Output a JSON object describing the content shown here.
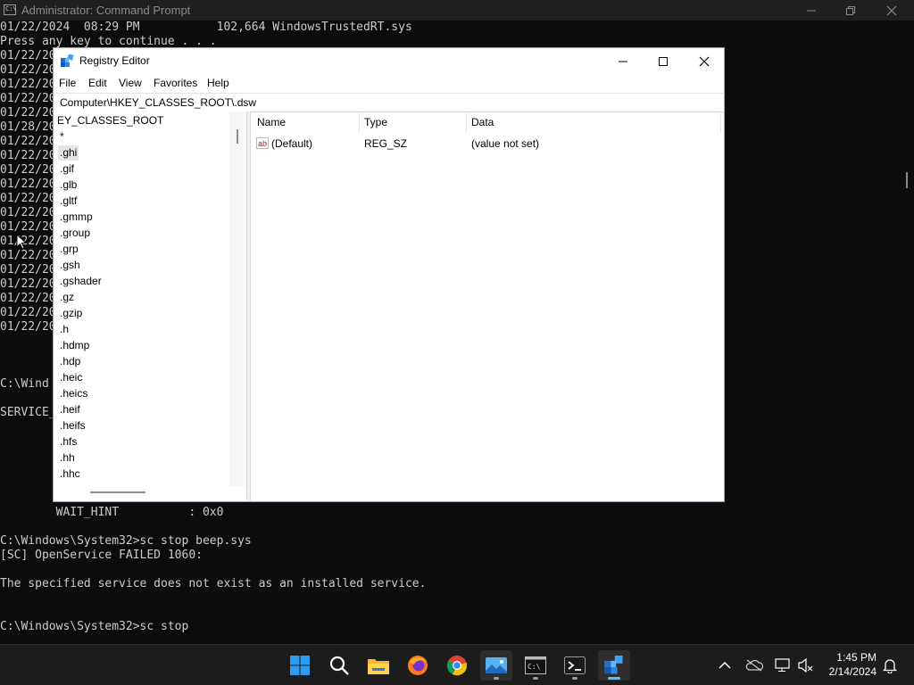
{
  "cmd": {
    "title": "Administrator: Command Prompt",
    "lines": [
      {
        "text": "01/22/2024  08:29 PM           102,664 WindowsTrustedRT.sys",
        "row": 0
      },
      {
        "text": "Press any key to continue . . .",
        "row": 1
      },
      {
        "text": "01/22/20",
        "row": 2
      },
      {
        "text": "01/22/20",
        "row": 3
      },
      {
        "text": "01/22/20",
        "row": 4
      },
      {
        "text": "01/22/20",
        "row": 5
      },
      {
        "text": "01/22/20",
        "row": 6
      },
      {
        "text": "01/28/20",
        "row": 7
      },
      {
        "text": "01/22/20",
        "row": 8
      },
      {
        "text": "01/22/20",
        "row": 9
      },
      {
        "text": "01/22/20",
        "row": 10
      },
      {
        "text": "01/22/20",
        "row": 11
      },
      {
        "text": "01/22/20",
        "row": 12
      },
      {
        "text": "01/22/20",
        "row": 13
      },
      {
        "text": "01/22/20",
        "row": 14
      },
      {
        "text": "01/22/20",
        "row": 15
      },
      {
        "text": "01/22/20",
        "row": 16
      },
      {
        "text": "01/22/20",
        "row": 17
      },
      {
        "text": "01/22/20",
        "row": 18
      },
      {
        "text": "01/22/20",
        "row": 19
      },
      {
        "text": "01/22/20",
        "row": 20
      },
      {
        "text": "01/22/20",
        "row": 21
      },
      {
        "text": "C:\\Wind",
        "row": 25
      },
      {
        "text": "SERVICE_",
        "row": 27
      },
      {
        "text": "        WAIT_HINT          : 0x0",
        "row": 34
      },
      {
        "text": "C:\\Windows\\System32>sc stop beep.sys",
        "row": 36
      },
      {
        "text": "[SC] OpenService FAILED 1060:",
        "row": 37
      },
      {
        "text": "The specified service does not exist as an installed service.",
        "row": 39
      },
      {
        "text": "C:\\Windows\\System32>sc stop",
        "row": 42
      }
    ]
  },
  "regedit": {
    "title": "Registry Editor",
    "menu": [
      "File",
      "Edit",
      "View",
      "Favorites",
      "Help"
    ],
    "address": "Computer\\HKEY_CLASSES_ROOT\\.dsw",
    "tree": [
      "EY_CLASSES_ROOT",
      "*",
      ".ghi",
      ".gif",
      ".glb",
      ".gltf",
      ".gmmp",
      ".group",
      ".grp",
      ".gsh",
      ".gshader",
      ".gz",
      ".gzip",
      ".h",
      ".hdmp",
      ".hdp",
      ".heic",
      ".heics",
      ".heif",
      ".heifs",
      ".hfs",
      ".hh",
      ".hhc"
    ],
    "tree_selected": ".ghi",
    "columns": {
      "name": "Name",
      "type": "Type",
      "data": "Data"
    },
    "values": [
      {
        "name": "(Default)",
        "type": "REG_SZ",
        "data": "(value not set)",
        "icon": "string-value-icon"
      }
    ]
  },
  "taskbar": {
    "apps": [
      {
        "name": "start-icon"
      },
      {
        "name": "search-icon"
      },
      {
        "name": "file-explorer-icon"
      },
      {
        "name": "firefox-icon"
      },
      {
        "name": "chrome-icon"
      },
      {
        "name": "photos-icon"
      },
      {
        "name": "command-prompt-icon"
      },
      {
        "name": "terminal-icon"
      },
      {
        "name": "registry-editor-icon"
      }
    ],
    "time": "1:45 PM",
    "date": "2/14/2024"
  }
}
